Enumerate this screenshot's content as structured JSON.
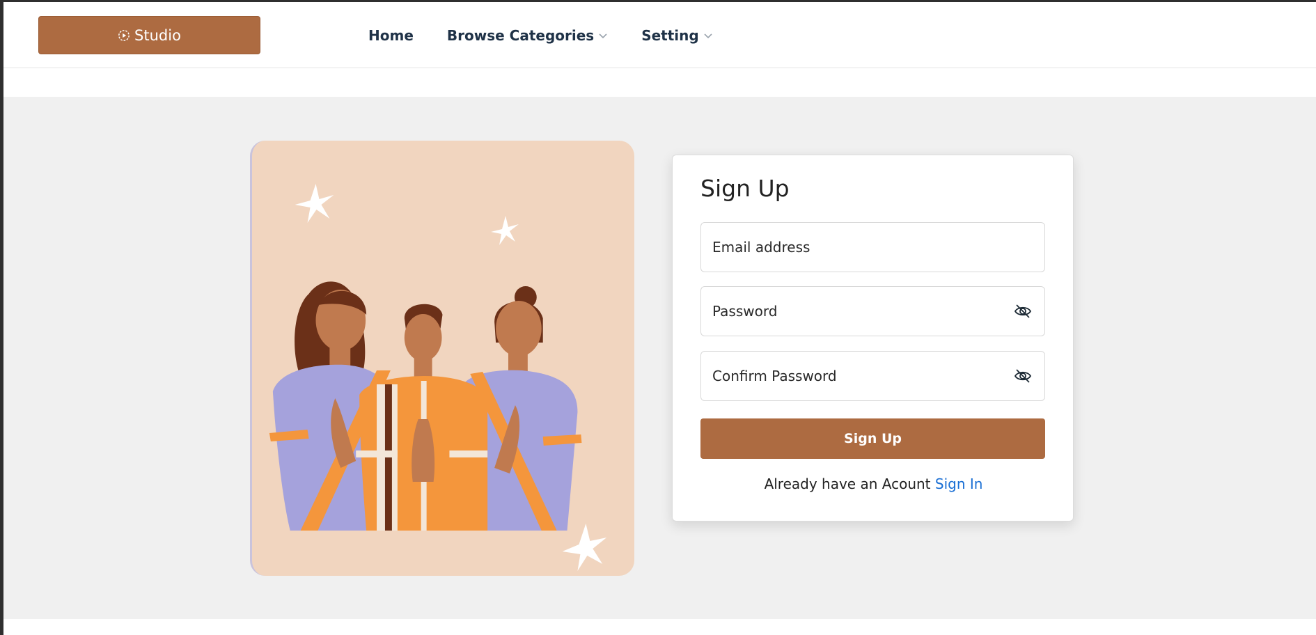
{
  "header": {
    "brand_label": "Studio",
    "nav": [
      {
        "label": "Home",
        "has_dropdown": false
      },
      {
        "label": "Browse Categories",
        "has_dropdown": true
      },
      {
        "label": "Setting",
        "has_dropdown": true
      }
    ]
  },
  "signup": {
    "title": "Sign Up",
    "email_placeholder": "Email address",
    "password_placeholder": "Password",
    "confirm_placeholder": "Confirm Password",
    "submit_label": "Sign Up",
    "already_text": "Already have an Acount",
    "signin_link": "Sign In"
  },
  "illustration": {
    "description_icon": "three-people-greeting-illustration"
  },
  "colors": {
    "brand": "#ad6b41",
    "link": "#1a6fd4",
    "nav_text": "#1f3247",
    "page_bg": "#f0f0f0",
    "illustration_bg": "#f1d5bf"
  }
}
